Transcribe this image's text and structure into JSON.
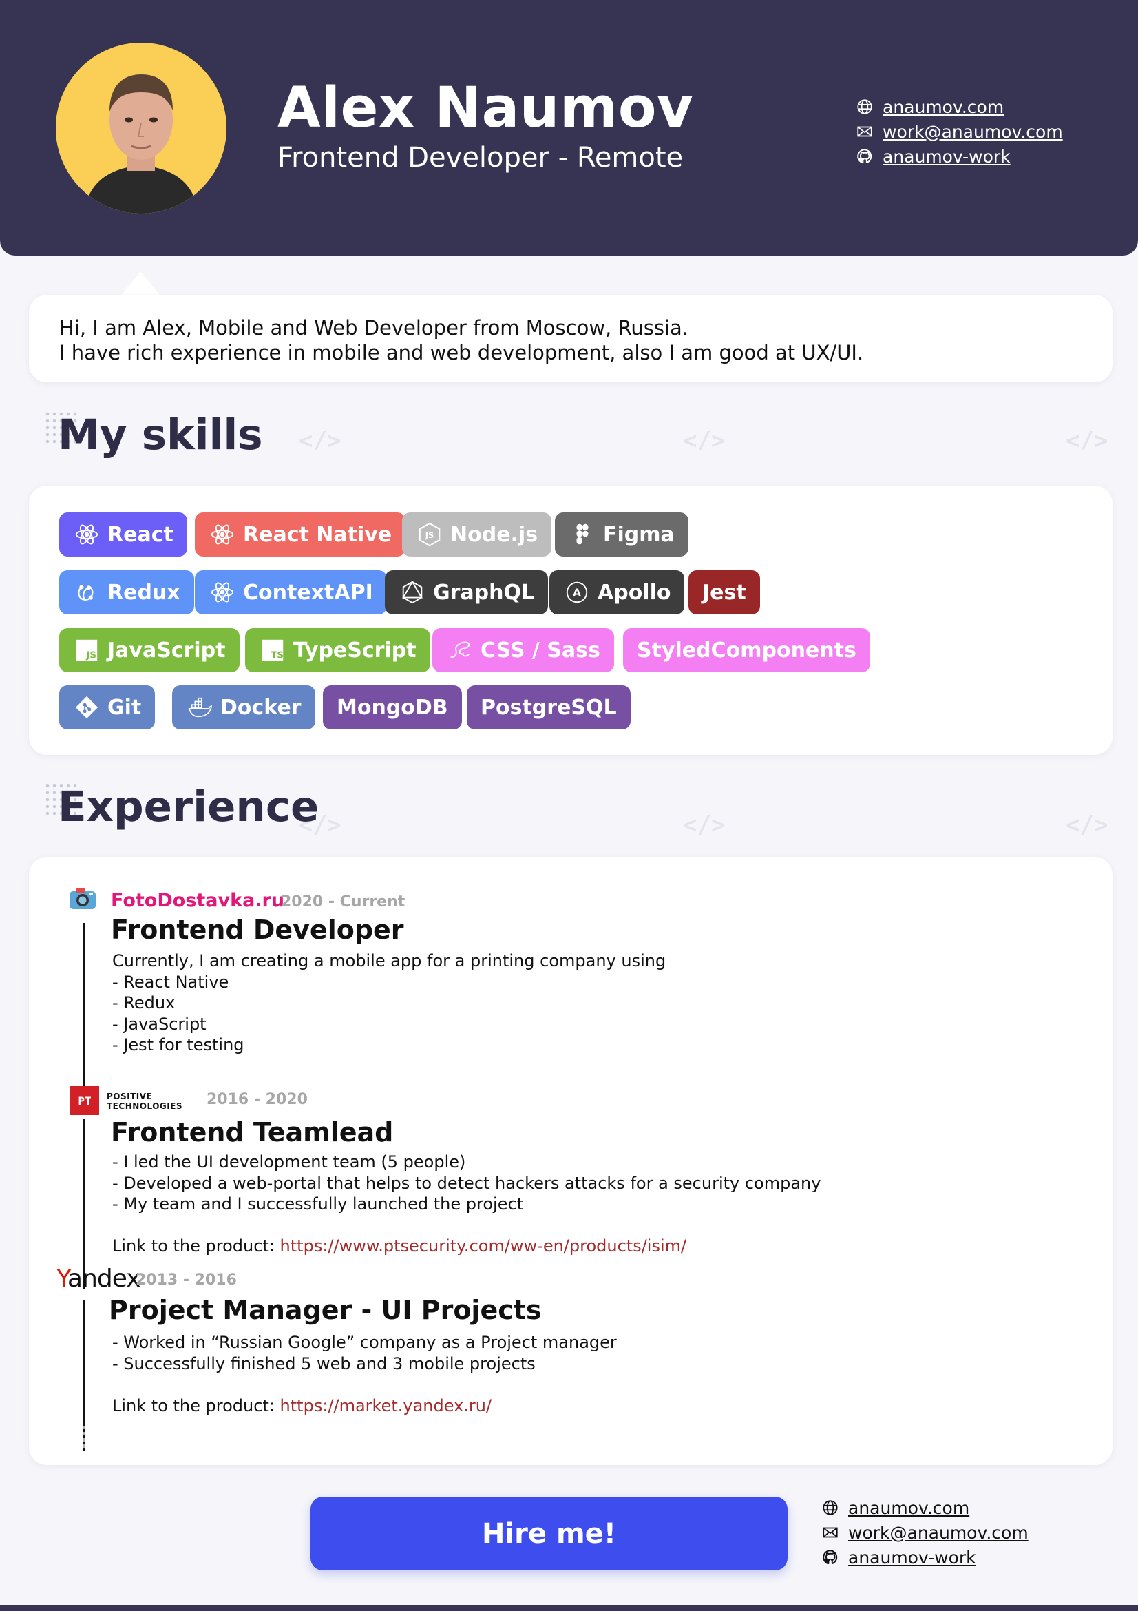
{
  "header": {
    "name": "Alex Naumov",
    "role": "Frontend Developer - Remote",
    "contacts": [
      {
        "icon": "globe-icon",
        "label": "anaumov.com"
      },
      {
        "icon": "mail-icon",
        "label": "work@anaumov.com"
      },
      {
        "icon": "github-icon",
        "label": "anaumov-work"
      }
    ]
  },
  "intro": {
    "line1": "Hi, I am Alex, Mobile and Web Developer from Moscow, Russia.",
    "line2": "I have rich experience in mobile and web development, also I am good at UX/UI."
  },
  "skills": {
    "title": "My skills",
    "items": [
      {
        "label": "React",
        "icon": "react-icon",
        "color": "#6c5ff7"
      },
      {
        "label": "React Native",
        "icon": "react-icon",
        "color": "#f06a63"
      },
      {
        "label": "Node.js",
        "icon": "nodejs-icon",
        "color": "#bdbdbd"
      },
      {
        "label": "Figma",
        "icon": "figma-icon",
        "color": "#6b6b6b"
      },
      {
        "label": "Redux",
        "icon": "redux-icon",
        "color": "#5f93f7"
      },
      {
        "label": "ContextAPI",
        "icon": "react-icon",
        "color": "#5f93f7"
      },
      {
        "label": "GraphQL",
        "icon": "graphql-icon",
        "color": "#3d3d3d"
      },
      {
        "label": "Apollo",
        "icon": "apollo-icon",
        "color": "#3d3d3d"
      },
      {
        "label": "Jest",
        "icon": "",
        "color": "#9a2727"
      },
      {
        "label": "JavaScript",
        "icon": "js-icon",
        "color": "#7dbb3f"
      },
      {
        "label": "TypeScript",
        "icon": "ts-icon",
        "color": "#7dbb3f"
      },
      {
        "label": "CSS / Sass",
        "icon": "sass-icon",
        "color": "#f37ff3"
      },
      {
        "label": "StyledComponents",
        "icon": "",
        "color": "#f37ff3"
      },
      {
        "label": "Git",
        "icon": "git-icon",
        "color": "#6384c5"
      },
      {
        "label": "Docker",
        "icon": "docker-icon",
        "color": "#6384c5"
      },
      {
        "label": "MongoDB",
        "icon": "",
        "color": "#7750a3"
      },
      {
        "label": "PostgreSQL",
        "icon": "",
        "color": "#7750a3"
      }
    ]
  },
  "experience": {
    "title": "Experience",
    "jobs": [
      {
        "company": "FotoDostavka.ru",
        "company_color": "#e2177a",
        "logo": "camera-icon",
        "period": "2020 - Current",
        "title": "Frontend Developer",
        "lines": [
          "Currently, I am creating a mobile app for a printing company using",
          "- React Native",
          "- Redux",
          "- JavaScript",
          "- Jest for testing"
        ]
      },
      {
        "company": "POSITIVE TECHNOLOGIES",
        "company_line1": "POSITIVE",
        "company_line2": "TECHNOLOGIES",
        "logo": "pt-logo",
        "logo_text": "PT",
        "period": "2016 - 2020",
        "title": "Frontend Teamlead",
        "lines": [
          "- I led the UI development team (5 people)",
          "- Developed a web-portal that helps to detect hackers attacks for a security company",
          "- My team and I successfully launched the project"
        ],
        "link_label": "Link to the product: ",
        "link": "https://www.ptsecurity.com/ww-en/products/isim/"
      },
      {
        "company": "Yandex",
        "logo": "yandex-logo",
        "period": "2013 - 2016",
        "title": "Project Manager - UI Projects",
        "lines": [
          "- Worked in “Russian Google” company as a Project manager",
          "- Successfully finished 5 web and 3 mobile projects"
        ],
        "link_label": "Link to the product: ",
        "link": "https://market.yandex.ru/"
      }
    ]
  },
  "cta": {
    "label": "Hire me!"
  },
  "colors": {
    "header_bg": "#363452",
    "cta_bg": "#3e4ded",
    "link": "#a62a2a"
  }
}
